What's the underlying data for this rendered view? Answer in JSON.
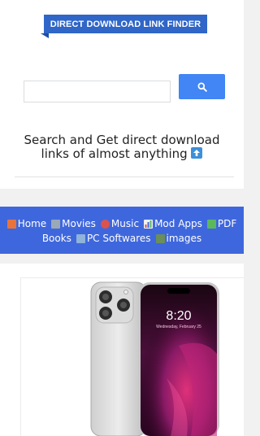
{
  "header": {
    "banner_title": "DIRECT DOWNLOAD LINK FINDER"
  },
  "search": {
    "placeholder": "",
    "value": "",
    "button_icon": "search-icon"
  },
  "tagline": {
    "text": "Search and Get direct download links of almost anything",
    "icon": "up-arrow-icon"
  },
  "nav": {
    "row1": [
      {
        "label": "Home",
        "icon": "house-icon",
        "color": "#e8743b"
      },
      {
        "label": "Movies",
        "icon": "tv-icon",
        "color": "#9aa8b8"
      },
      {
        "label": "Music",
        "icon": "guitar-icon",
        "color": "#d9534f"
      },
      {
        "label": "Mod Apps",
        "icon": "chart-icon",
        "color": "#f0f0f0"
      },
      {
        "label": "PDF",
        "icon": "green-book-icon",
        "color": "#5cb85c"
      }
    ],
    "row2": [
      {
        "label": "Books",
        "icon": "",
        "color": ""
      },
      {
        "label": "PC Softwares",
        "icon": "laptop-icon",
        "color": "#8fb3d9"
      },
      {
        "label": "images",
        "icon": "picture-icon",
        "color": "#6b8e5a"
      }
    ]
  },
  "content": {
    "product_image": "smartphone-image",
    "phone_time": "8:20",
    "phone_date": "Wednesday, February 25"
  },
  "colors": {
    "banner": "#2f66c7",
    "search_button": "#4285f4",
    "nav_bar": "#3f67dd"
  }
}
